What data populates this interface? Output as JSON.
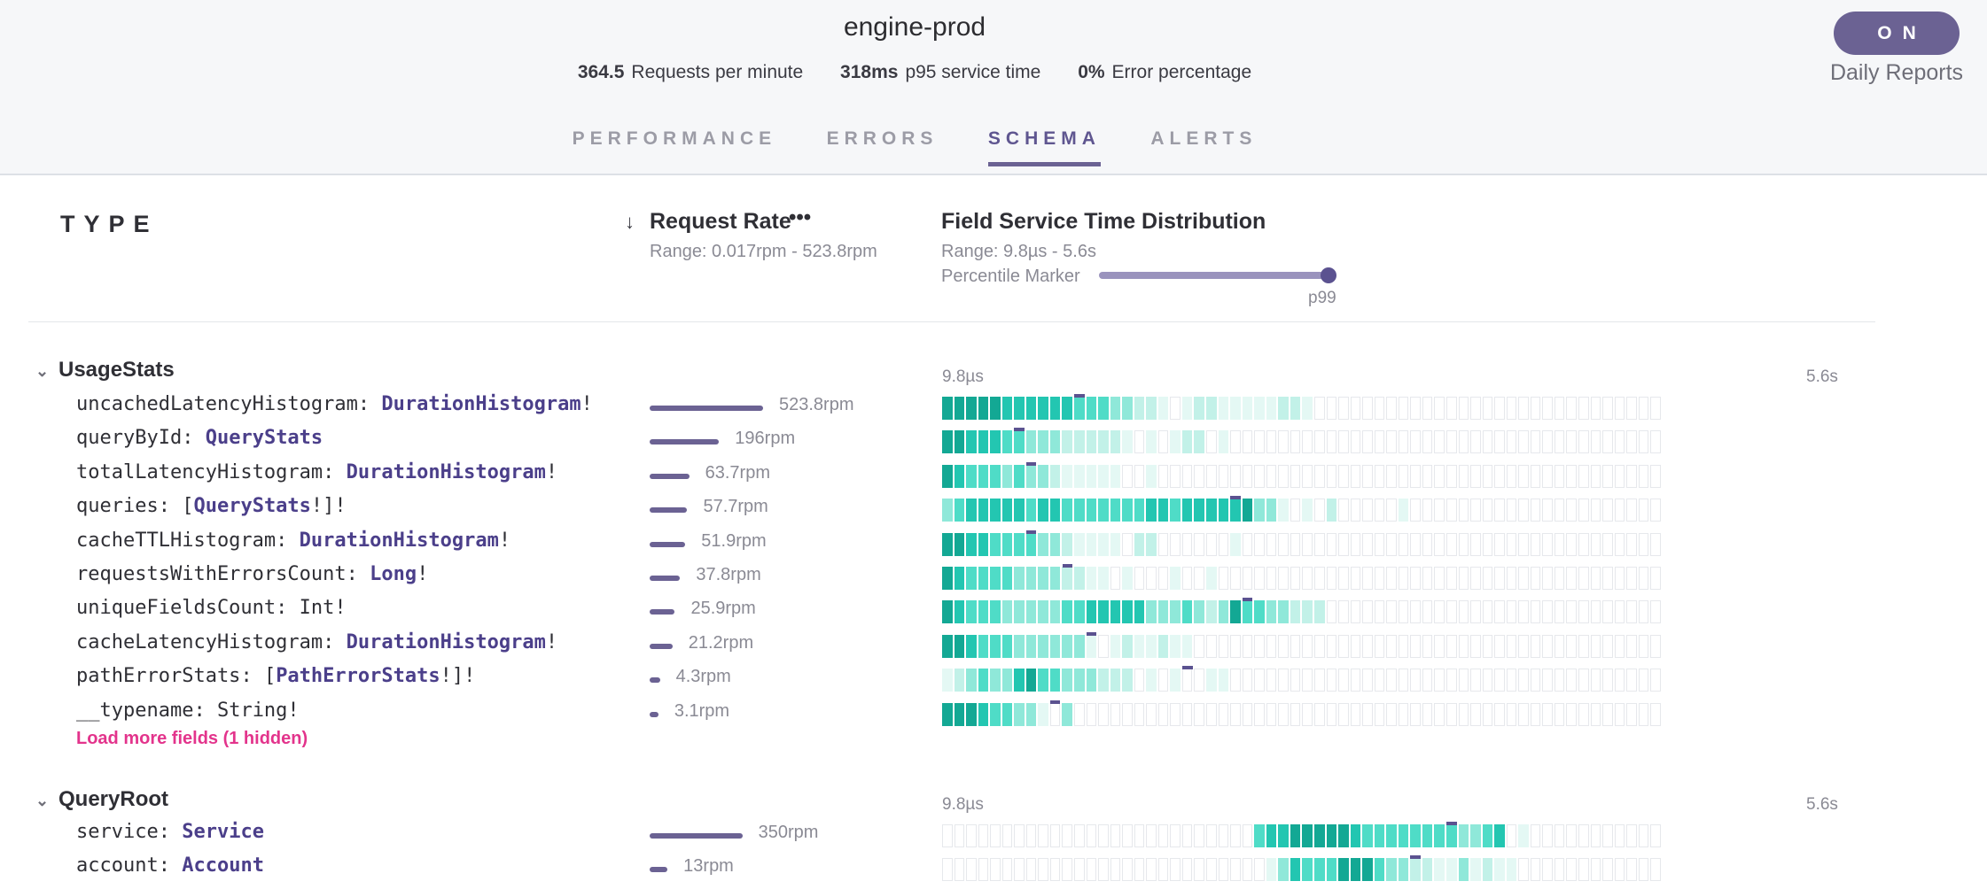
{
  "header": {
    "service_name": "engine-prod",
    "stats": [
      {
        "value": "364.5",
        "label": "Requests per minute"
      },
      {
        "value": "318ms",
        "label": "p95 service time"
      },
      {
        "value": "0%",
        "label": "Error percentage"
      }
    ],
    "toggle": {
      "label": "ON",
      "caption": "Daily Reports"
    }
  },
  "tabs": [
    {
      "label": "PERFORMANCE",
      "active": false
    },
    {
      "label": "ERRORS",
      "active": false
    },
    {
      "label": "SCHEMA",
      "active": true
    },
    {
      "label": "ALERTS",
      "active": false
    }
  ],
  "columns": {
    "type_title": "TYPE",
    "sort_arrow": "↓",
    "rate_title": "Request Rate",
    "rate_more": "•••",
    "rate_range": "Range: 0.017rpm - 523.8rpm",
    "dist_title": "Field Service Time Distribution",
    "dist_range": "Range: 9.8µs - 5.6s",
    "percentile_label": "Percentile Marker",
    "percentile_value": "p99",
    "percentile_fraction": 1.0
  },
  "colors": {
    "accent": "#6b6293",
    "type_name": "#4b3f8a",
    "load_more": "#e3348c",
    "heat": [
      "#ffffff",
      "#e4f8f4",
      "#c2f1e8",
      "#8fe8d9",
      "#4fdcc7",
      "#23c6b1",
      "#13a894"
    ]
  },
  "rate_max": 523.8,
  "groups": [
    {
      "name": "UsageStats",
      "chevron": "⌄",
      "axis_min": "9.8µs",
      "axis_max": "5.6s",
      "load_more": "Load more fields (1 hidden)",
      "fields": [
        {
          "name": "uncachedLatencyHistogram",
          "sep": ": ",
          "pre": "",
          "type": "DurationHistogram",
          "post": "!",
          "rate": 523.8,
          "rate_label": "523.8rpm",
          "heat": "666665555554443322101221111122100000000000000000000000000000",
          "p99_cell": 11
        },
        {
          "name": "queryById",
          "sep": ": ",
          "pre": "",
          "type": "QueryStats",
          "post": "",
          "rate": 196,
          "rate_label": "196rpm",
          "heat": "665554433322222101012201000000000000000000000000000000000000",
          "p99_cell": 6
        },
        {
          "name": "totalLatencyHistogram",
          "sep": ": ",
          "pre": "",
          "type": "DurationHistogram",
          "post": "!",
          "rate": 63.7,
          "rate_label": "63.7rpm",
          "heat": "654443433211111001000000000000000000000000000000000000000000",
          "p99_cell": 7
        },
        {
          "name": "queries",
          "sep": ": ",
          "pre": "[",
          "type": "QueryStats",
          "post": "!]!",
          "rate": 57.7,
          "rate_label": "57.7rpm",
          "heat": "345555545544444445545555563310102000001000000000000000000000",
          "p99_cell": 24
        },
        {
          "name": "cacheTTLHistogram",
          "sep": ": ",
          "pre": "",
          "type": "DurationHistogram",
          "post": "!",
          "rate": 51.9,
          "rate_label": "51.9rpm",
          "heat": "665544443321111022000000100000000000000000000000000000000000",
          "p99_cell": 7
        },
        {
          "name": "requestsWithErrorsCount",
          "sep": ": ",
          "pre": "",
          "type": "Long",
          "post": "!",
          "rate": 37.8,
          "rate_label": "37.8rpm",
          "heat": "654444333322110100010010000000000000000000000000000000000000",
          "p99_cell": 10
        },
        {
          "name": "uniqueFieldsCount",
          "sep": ": ",
          "pre": "",
          "type": "",
          "post": "Int!",
          "rate": 25.9,
          "rate_label": "25.9rpm",
          "heat": "654443333344555553334323644332220000000000000000000000000000",
          "p99_cell": 25
        },
        {
          "name": "cacheLatencyHistogram",
          "sep": ": ",
          "pre": "",
          "type": "DurationHistogram",
          "post": "!",
          "rate": 21.2,
          "rate_label": "21.2rpm",
          "heat": "665444333333101211211000000000000000000000000000000000000000",
          "p99_cell": 12
        },
        {
          "name": "pathErrorStats",
          "sep": ": ",
          "pre": "[",
          "type": "PathErrorStats",
          "post": "!]!",
          "rate": 4.3,
          "rate_label": "4.3rpm",
          "heat": "123433564433322201010011000000000000000000000000000000000000",
          "p99_cell": 20
        },
        {
          "name": "__typename",
          "sep": ": ",
          "pre": "",
          "type": "",
          "post": "String!",
          "rate": 3.1,
          "rate_label": "3.1rpm",
          "heat": "666544331030000000000000000000000000000000000000000000000000",
          "p99_cell": 9
        }
      ]
    },
    {
      "name": "QueryRoot",
      "chevron": "⌄",
      "axis_min": "9.8µs",
      "axis_max": "5.6s",
      "fields": [
        {
          "name": "service",
          "sep": ": ",
          "pre": "",
          "type": "Service",
          "post": "",
          "rate": 350,
          "rate_label": "350rpm",
          "heat": "000000000000000000000000004556666654444444433450100000000000",
          "p99_cell": 42
        },
        {
          "name": "account",
          "sep": ": ",
          "pre": "",
          "type": "Account",
          "post": "",
          "rate": 13,
          "rate_label": "13rpm",
          "heat": "000000000000000000000000000135444666433221131211000000000000",
          "p99_cell": 39
        }
      ]
    }
  ]
}
